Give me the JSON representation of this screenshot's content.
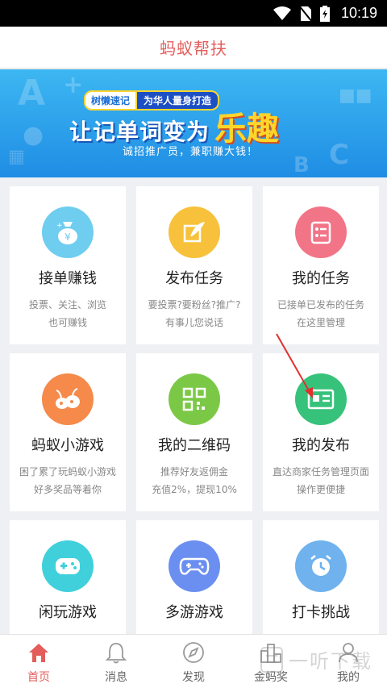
{
  "status_bar": {
    "time": "10:19",
    "icons": [
      "wifi-icon",
      "no-sim-icon",
      "battery-charging-icon"
    ]
  },
  "header": {
    "title": "蚂蚁帮扶"
  },
  "banner": {
    "brand": "树懒速记",
    "slogan": "为华人量身打造",
    "headline": "让记单词变为",
    "highlight": "乐趣",
    "subtext": "诚招推广员，兼职赚大钱！"
  },
  "cards": [
    {
      "title": "接单赚钱",
      "desc1": "投票、关注、浏览",
      "desc2": "也可赚钱",
      "icon": "money-bag-icon",
      "color": "#6fcdf0"
    },
    {
      "title": "发布任务",
      "desc1": "要投票?要粉丝?推广?",
      "desc2": "有事儿您说话",
      "icon": "quill-edit-icon",
      "color": "#f7c13b"
    },
    {
      "title": "我的任务",
      "desc1": "已接单已发布的任务",
      "desc2": "在这里管理",
      "icon": "checklist-icon",
      "color": "#f27487"
    },
    {
      "title": "蚂蚁小游戏",
      "desc1": "困了累了玩蚂蚁小游戏",
      "desc2": "好多奖品等着你",
      "icon": "ant-icon",
      "color": "#f58a4b"
    },
    {
      "title": "我的二维码",
      "desc1": "推荐好友返佣金",
      "desc2": "充值2%，提现10%",
      "icon": "qr-code-icon",
      "color": "#7bc846"
    },
    {
      "title": "我的发布",
      "desc1": "直达商家任务管理页面",
      "desc2": "操作更便捷",
      "icon": "publish-card-icon",
      "color": "#36c27a"
    },
    {
      "title": "闲玩游戏",
      "desc1": "",
      "desc2": "",
      "icon": "gamepad-icon",
      "color": "#3fd0dc"
    },
    {
      "title": "多游游戏",
      "desc1": "",
      "desc2": "",
      "icon": "controller-icon",
      "color": "#6b8ff0"
    },
    {
      "title": "打卡挑战",
      "desc1": "",
      "desc2": "",
      "icon": "alarm-clock-icon",
      "color": "#6fb2ee"
    }
  ],
  "nav": [
    {
      "label": "首页",
      "icon": "home-icon",
      "active": true
    },
    {
      "label": "消息",
      "icon": "bell-icon",
      "active": false
    },
    {
      "label": "发现",
      "icon": "compass-icon",
      "active": false
    },
    {
      "label": "金蚂奖",
      "icon": "podium-icon",
      "active": false
    },
    {
      "label": "我的",
      "icon": "user-icon",
      "active": false
    }
  ],
  "watermark": {
    "text": "一听下载"
  },
  "colors": {
    "accent": "#e35d5b",
    "background": "#eef0f4",
    "annotation_arrow": "#e03030"
  }
}
